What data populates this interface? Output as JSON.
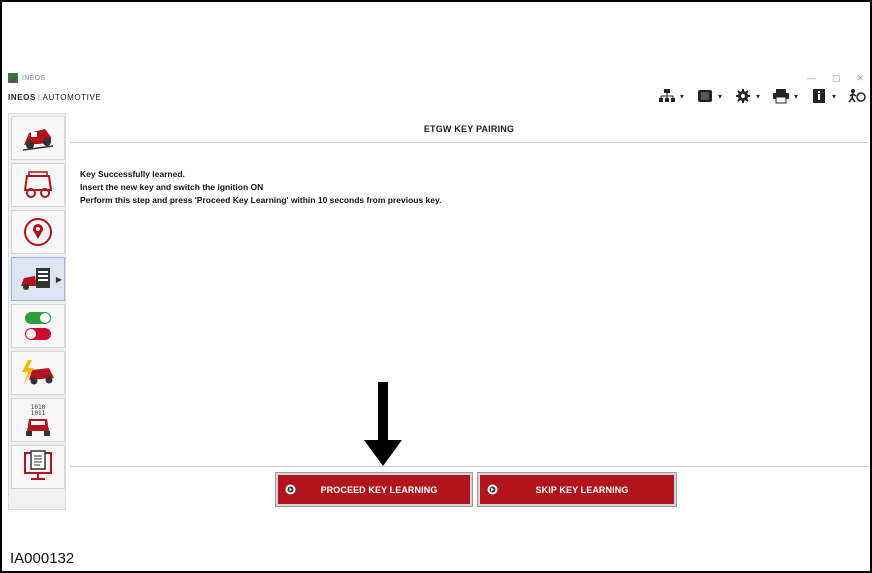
{
  "window": {
    "app_title": "INEOS",
    "controls": [
      "—",
      "▢",
      "✕"
    ]
  },
  "brand": {
    "name_left": "INEOS",
    "name_right": "AUTOMOTIVE"
  },
  "toolbar": {
    "items": [
      {
        "icon": "network-icon"
      },
      {
        "icon": "vci-device-icon"
      },
      {
        "icon": "settings-gear-icon"
      },
      {
        "icon": "printer-icon"
      },
      {
        "icon": "info-book-icon"
      },
      {
        "icon": "exit-run-icon"
      }
    ]
  },
  "sidebar": {
    "items": [
      {
        "icon": "vehicle-offroad-icon",
        "active": false
      },
      {
        "icon": "vehicle-diagnostics-icon",
        "active": false
      },
      {
        "icon": "map-location-icon",
        "active": false
      },
      {
        "icon": "vehicle-checklist-icon",
        "active": true
      },
      {
        "icon": "toggle-switches-icon",
        "active": false
      },
      {
        "icon": "vehicle-electrical-icon",
        "active": false
      },
      {
        "icon": "vehicle-binary-icon",
        "active": false
      },
      {
        "icon": "document-monitor-icon",
        "active": false
      }
    ]
  },
  "panel": {
    "title": "ETGW KEY PAIRING",
    "messages": [
      "Key Successfully learned.",
      "Insert the new key and switch the ignition ON",
      "Perform this step and press 'Proceed Key Learning' within 10 seconds from previous key."
    ]
  },
  "actions": {
    "proceed_label": "PROCEED KEY LEARNING",
    "skip_label": "SKIP KEY LEARNING"
  },
  "caption": "IA000132",
  "colors": {
    "button_red": "#b1141c",
    "sidebar_active": "#dbe6f2"
  }
}
